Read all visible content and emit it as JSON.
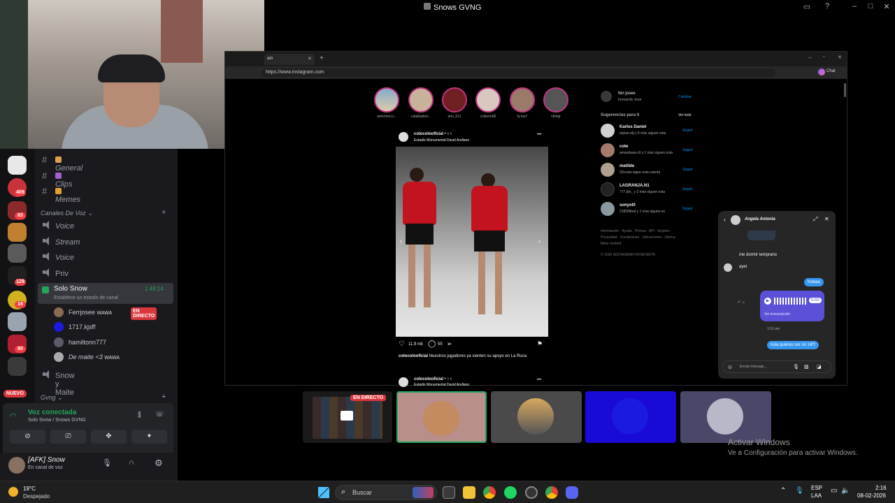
{
  "window": {
    "title": "Snows GVNG"
  },
  "webcam": {
    "description_hidden": true
  },
  "channels": {
    "text": [
      {
        "name": "General"
      },
      {
        "name": "Clips"
      },
      {
        "name": "Memes"
      }
    ],
    "voice_category": "Canales De Voz",
    "voice": [
      {
        "name": "Voice"
      },
      {
        "name": "Stream"
      },
      {
        "name": "Voice"
      },
      {
        "name": "Priv"
      }
    ],
    "active": {
      "name": "Solo Snow",
      "timer": "1:49:14",
      "status": "Establece un estado de canal"
    },
    "members": [
      {
        "name": "Ferrjosee",
        "tag": "WAWA",
        "badge": "EN DIRECTO"
      },
      {
        "name": "1717.kjsff"
      },
      {
        "name": "hamiltonn777"
      },
      {
        "name": "De maite <3",
        "tag": "WAWA"
      }
    ],
    "other_voice": "Snow y Maite",
    "other_category": "Gvng",
    "new_badge": "NUEVO"
  },
  "guild_badges": [
    "409",
    "63",
    "129",
    "16",
    "80"
  ],
  "voice_panel": {
    "status": "Voz conectada",
    "location": "Solo Snow / Snows GVNG"
  },
  "user": {
    "name": "[AFK] Snow",
    "status": "En canal de voz"
  },
  "browser": {
    "tab": "am",
    "url": "https://www.instagram.com",
    "chat_label": "Chat"
  },
  "instagram": {
    "stories": [
      "amnnnnn.t...",
      "catalinahel...",
      "ann_011",
      "cvklenn06",
      "fy.iuu7",
      "nlelrgr"
    ],
    "post": {
      "user": "colocolooficial",
      "time": "6 h",
      "location": "Estadio Monumental David Arellano",
      "likes": "11,9 mil",
      "comments": "55",
      "caption_user": "colocolooficial",
      "caption": "Nuestros jugadores ya sienten su apoyo en La Ruca",
      "next_user": "colocolooficial",
      "next_time": "1 h",
      "next_location": "Estadio Monumental David Arellano"
    },
    "profile": {
      "user": "ferr.josee",
      "name": "Fernando Jose",
      "switch": "Cambiar"
    },
    "suggestions_title": "Sugerencias para ti",
    "see_all": "Ver todo",
    "suggestions": [
      {
        "name": "Karlos Daniel",
        "sub": "rejose.rdj y 6 más siguen esta",
        "action": "Seguir"
      },
      {
        "name": "cote",
        "sub": "amandaaa.clt y 1 más siguen esta",
        "action": "Seguir"
      },
      {
        "name": "matilda",
        "sub": "22costa sigue esta cuenta",
        "action": "Seguir"
      },
      {
        "name": "LAGRANJA.N1",
        "sub": "777.jbo_ y 3 más siguen esta",
        "action": "Seguir"
      },
      {
        "name": "sonyol0",
        "sub": "21820lbod y 1 más siguen es",
        "action": "Seguir"
      }
    ],
    "footer1": "Información · Ayuda · Prensa · API · Empleo ·",
    "footer2": "Privacidad · Condiciones · Ubicaciones · Idioma ·",
    "footer3": "Meta Verified",
    "copyright": "© 2026 INSTAGRAM FROM META",
    "dm": {
      "name": "Angela Antonia",
      "messages": [
        {
          "from": "them",
          "text": "me dormir temprano"
        },
        {
          "from": "them",
          "text": "ayer"
        },
        {
          "from": "me",
          "text": "holaaa"
        },
        {
          "from": "me",
          "text": "0:00",
          "kind": "audio"
        },
        {
          "from": "them",
          "text": "Ver transcripción"
        },
        {
          "from": "system",
          "text": "3:16 am"
        },
        {
          "from": "me",
          "text": "hola quieres ser mi 14f?"
        }
      ],
      "input_placeholder": "Enviar mensaje..."
    }
  },
  "stream_tiles": {
    "live_label": "EN DIRECTO"
  },
  "watermark": {
    "line1": "Activar Windows",
    "line2": "Ve a Configuración para activar Windows."
  },
  "taskbar": {
    "weather_temp": "19°C",
    "weather_text": "Despejado",
    "search": "Buscar",
    "lang1": "ESP",
    "lang2": "LAA",
    "time": "2:16",
    "date": "08-02-2026"
  }
}
